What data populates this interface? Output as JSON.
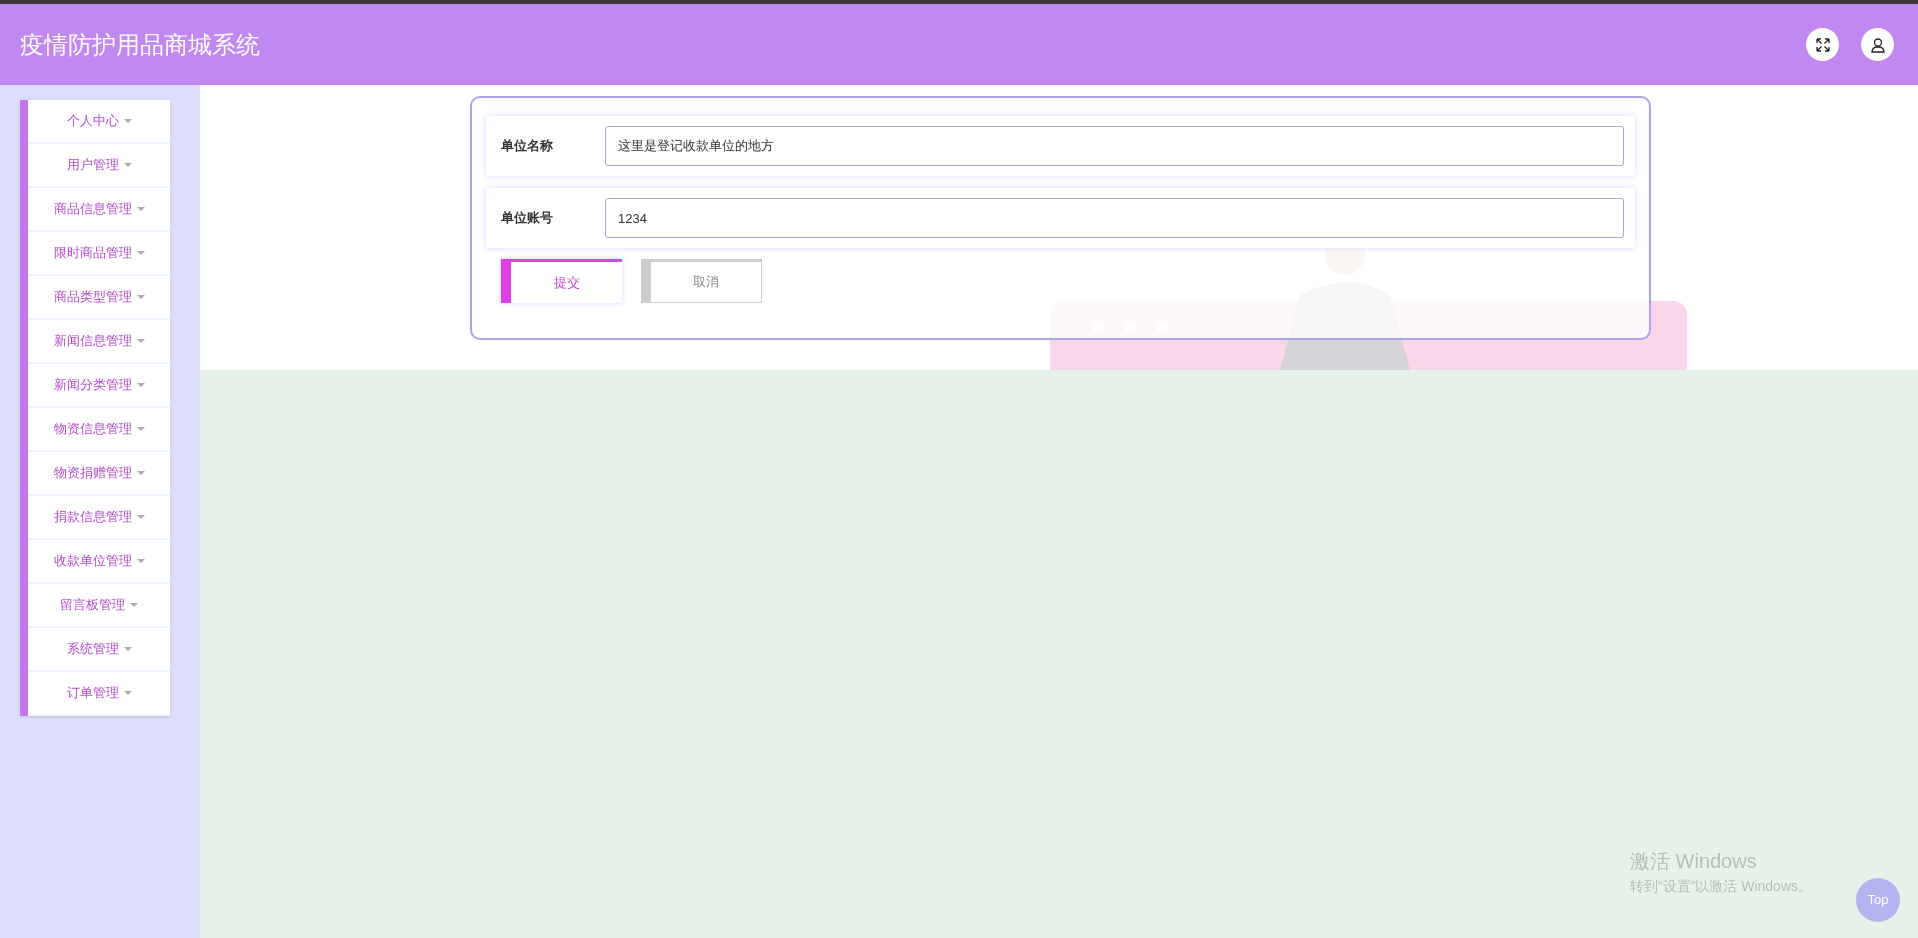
{
  "header": {
    "title": "疫情防护用品商城系统"
  },
  "sidebar": {
    "items": [
      {
        "label": "个人中心"
      },
      {
        "label": "用户管理"
      },
      {
        "label": "商品信息管理"
      },
      {
        "label": "限时商品管理"
      },
      {
        "label": "商品类型管理"
      },
      {
        "label": "新闻信息管理"
      },
      {
        "label": "新闻分类管理"
      },
      {
        "label": "物资信息管理"
      },
      {
        "label": "物资捐赠管理"
      },
      {
        "label": "捐款信息管理"
      },
      {
        "label": "收款单位管理"
      },
      {
        "label": "留言板管理"
      },
      {
        "label": "系统管理"
      },
      {
        "label": "订单管理"
      }
    ]
  },
  "form": {
    "fields": [
      {
        "label": "单位名称",
        "value": "这里是登记收款单位的地方"
      },
      {
        "label": "单位账号",
        "value": "1234"
      }
    ],
    "buttons": [
      {
        "label": "提交",
        "kind": "primary"
      },
      {
        "label": "取消",
        "kind": "secondary"
      }
    ]
  },
  "os_notice": {
    "title": "激活 Windows",
    "text": "转到“设置”以激活 Windows。"
  },
  "back_to_top": "Top"
}
